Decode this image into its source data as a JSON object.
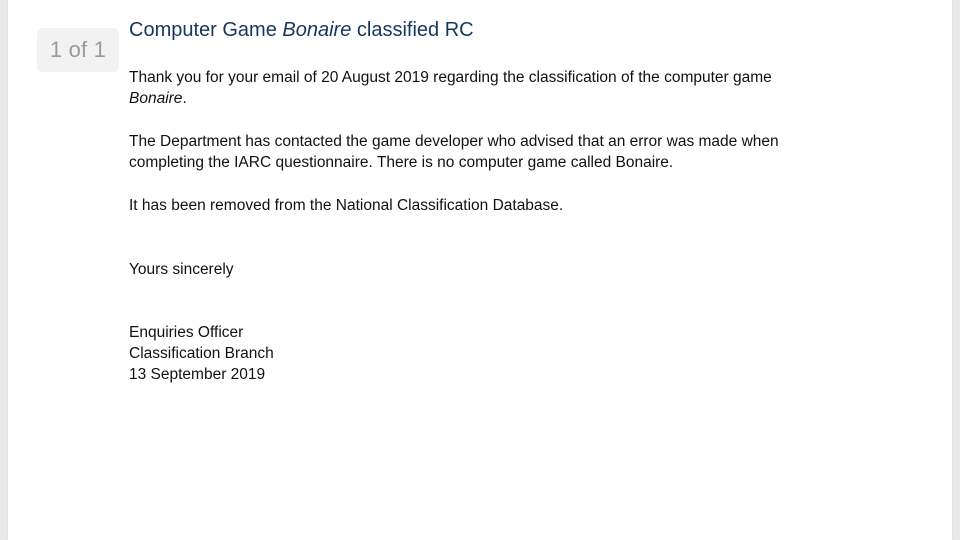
{
  "page_indicator": "1 of 1",
  "title": {
    "prefix": "Computer Game ",
    "emphasis": "Bonaire",
    "suffix": " classified RC"
  },
  "paragraphs": {
    "p1": {
      "line1": "Thank you for your email of 20 August 2019 regarding the classification of the computer game",
      "emphasis": "Bonaire",
      "suffix": "."
    },
    "p2": {
      "line1": "The Department has contacted the game developer who advised that an error was made when",
      "line2": "completing the IARC questionnaire. There is no computer game called Bonaire."
    },
    "p3": "It has been removed from the National Classification Database.",
    "closing": "Yours sincerely",
    "signature": {
      "name": "Enquiries Officer",
      "branch": "Classification Branch",
      "date": "13 September 2019"
    }
  }
}
